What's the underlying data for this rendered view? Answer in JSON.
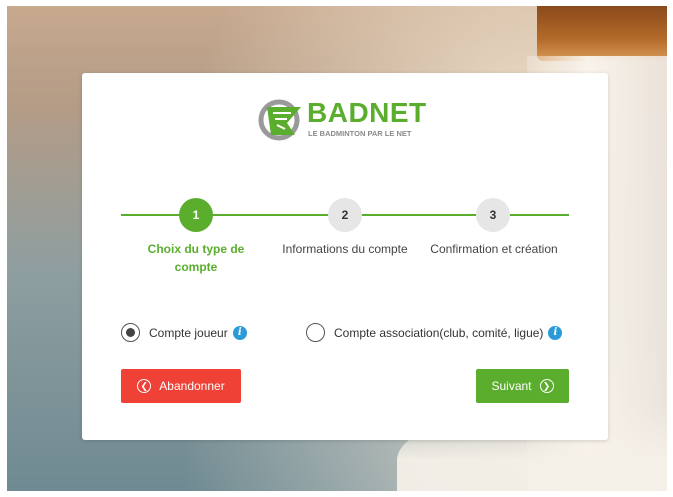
{
  "brand": {
    "name": "BADNET",
    "tagline": "LE BADMINTON PAR LE NET",
    "color": "#5bad2e"
  },
  "stepper": {
    "steps": [
      {
        "number": "1",
        "label": "Choix du type de compte",
        "state": "active"
      },
      {
        "number": "2",
        "label": "Informations du compte",
        "state": "inactive"
      },
      {
        "number": "3",
        "label": "Confirmation et création",
        "state": "inactive"
      }
    ]
  },
  "account_type": {
    "options": [
      {
        "label": "Compte joueur",
        "selected": true,
        "icon": "info-icon"
      },
      {
        "label": "Compte association(club, comité, ligue)",
        "selected": false,
        "icon": "info-icon"
      }
    ]
  },
  "actions": {
    "cancel": {
      "label": "Abandonner",
      "icon": "chevron-left-circle-icon",
      "color": "#ef4136"
    },
    "next": {
      "label": "Suivant",
      "icon": "chevron-right-circle-icon",
      "color": "#5bad2e"
    }
  }
}
